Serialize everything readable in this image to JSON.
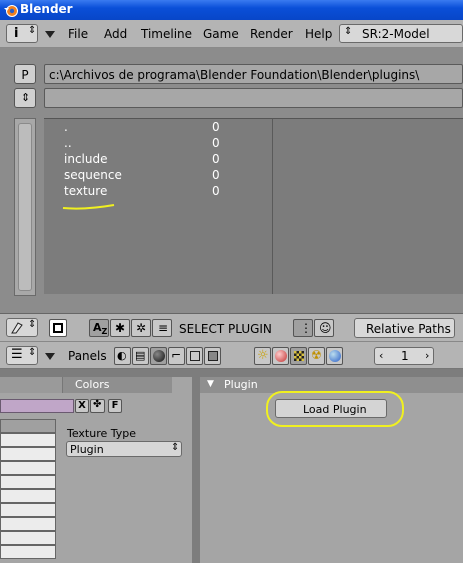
{
  "window": {
    "title": "Blender"
  },
  "info_header": {
    "menu": [
      "File",
      "Add",
      "Timeline",
      "Game",
      "Render",
      "Help"
    ],
    "scene": "SR:2-Model"
  },
  "file_browser": {
    "parent_button": "P",
    "path": "c:\\Archivos de programa\\Blender Foundation\\Blender\\plugins\\",
    "filter": "",
    "files": [
      {
        "name": ".",
        "size": "0"
      },
      {
        "name": "..",
        "size": "0"
      },
      {
        "name": "include",
        "size": "0"
      },
      {
        "name": "sequence",
        "size": "0"
      },
      {
        "name": "texture",
        "size": "0"
      }
    ],
    "header": {
      "mode_label": "SELECT PLUGIN",
      "relative_paths": "Relative Paths"
    }
  },
  "buttons_header": {
    "panels_label": "Panels",
    "frame": "1"
  },
  "texture_panel": {
    "tab_colors": "Colors",
    "x_button": "X",
    "f_button": "F",
    "texture_type_label": "Texture Type",
    "texture_type_value": "Plugin"
  },
  "plugin_panel": {
    "title": "Plugin",
    "load_button": "Load Plugin"
  },
  "colors": {
    "annotation": "#f0f020"
  }
}
